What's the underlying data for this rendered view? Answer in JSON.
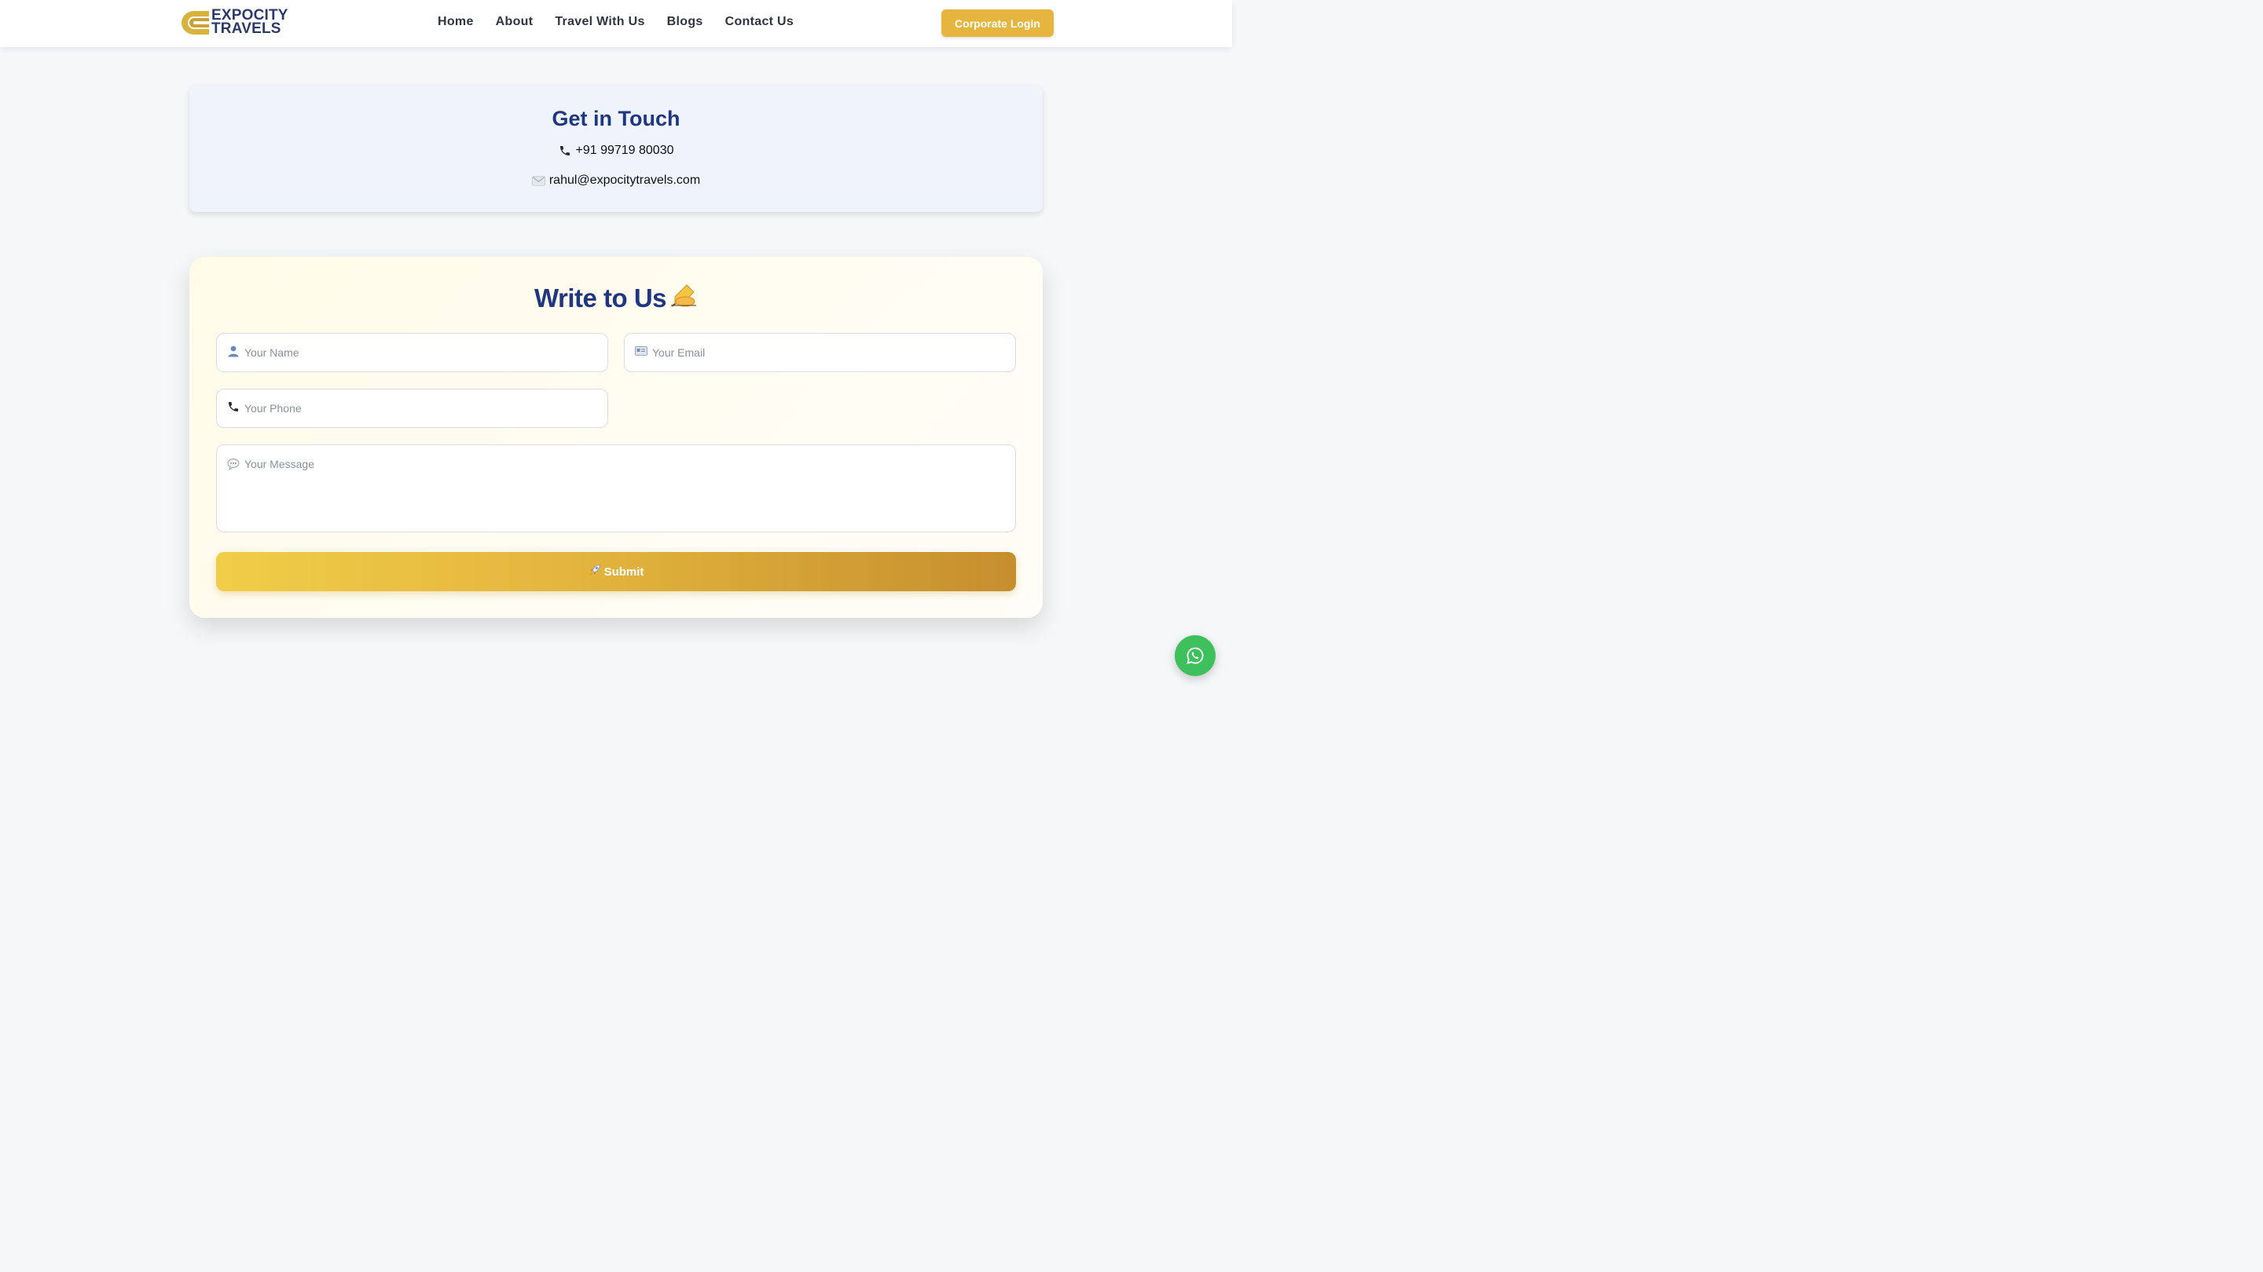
{
  "brand": {
    "line1": "EXPOCITY",
    "line2": "TRAVELS",
    "colors": {
      "primary": "#2b3a6b",
      "gold": "#d8b23d"
    }
  },
  "nav": {
    "links": [
      "Home",
      "About",
      "Travel With Us",
      "Blogs",
      "Contact Us"
    ],
    "corporate_login": "Corporate Login"
  },
  "contact": {
    "title": "Get in Touch",
    "phone": "+91 99719 80030",
    "email": "rahul@expocitytravels.com",
    "phone_icon": "phone-icon",
    "email_icon": "envelope-icon"
  },
  "form": {
    "title": "Write to Us",
    "title_icon": "writing-hand-icon",
    "name_placeholder": "Your Name",
    "email_placeholder": "Your Email",
    "phone_placeholder": "Your Phone",
    "message_placeholder": "Your Message",
    "submit_label": "Submit",
    "submit_icon": "rocket-icon"
  },
  "colors": {
    "heading": "#1f3680",
    "accent": "#e5b53e",
    "whatsapp": "#3ec15d"
  }
}
